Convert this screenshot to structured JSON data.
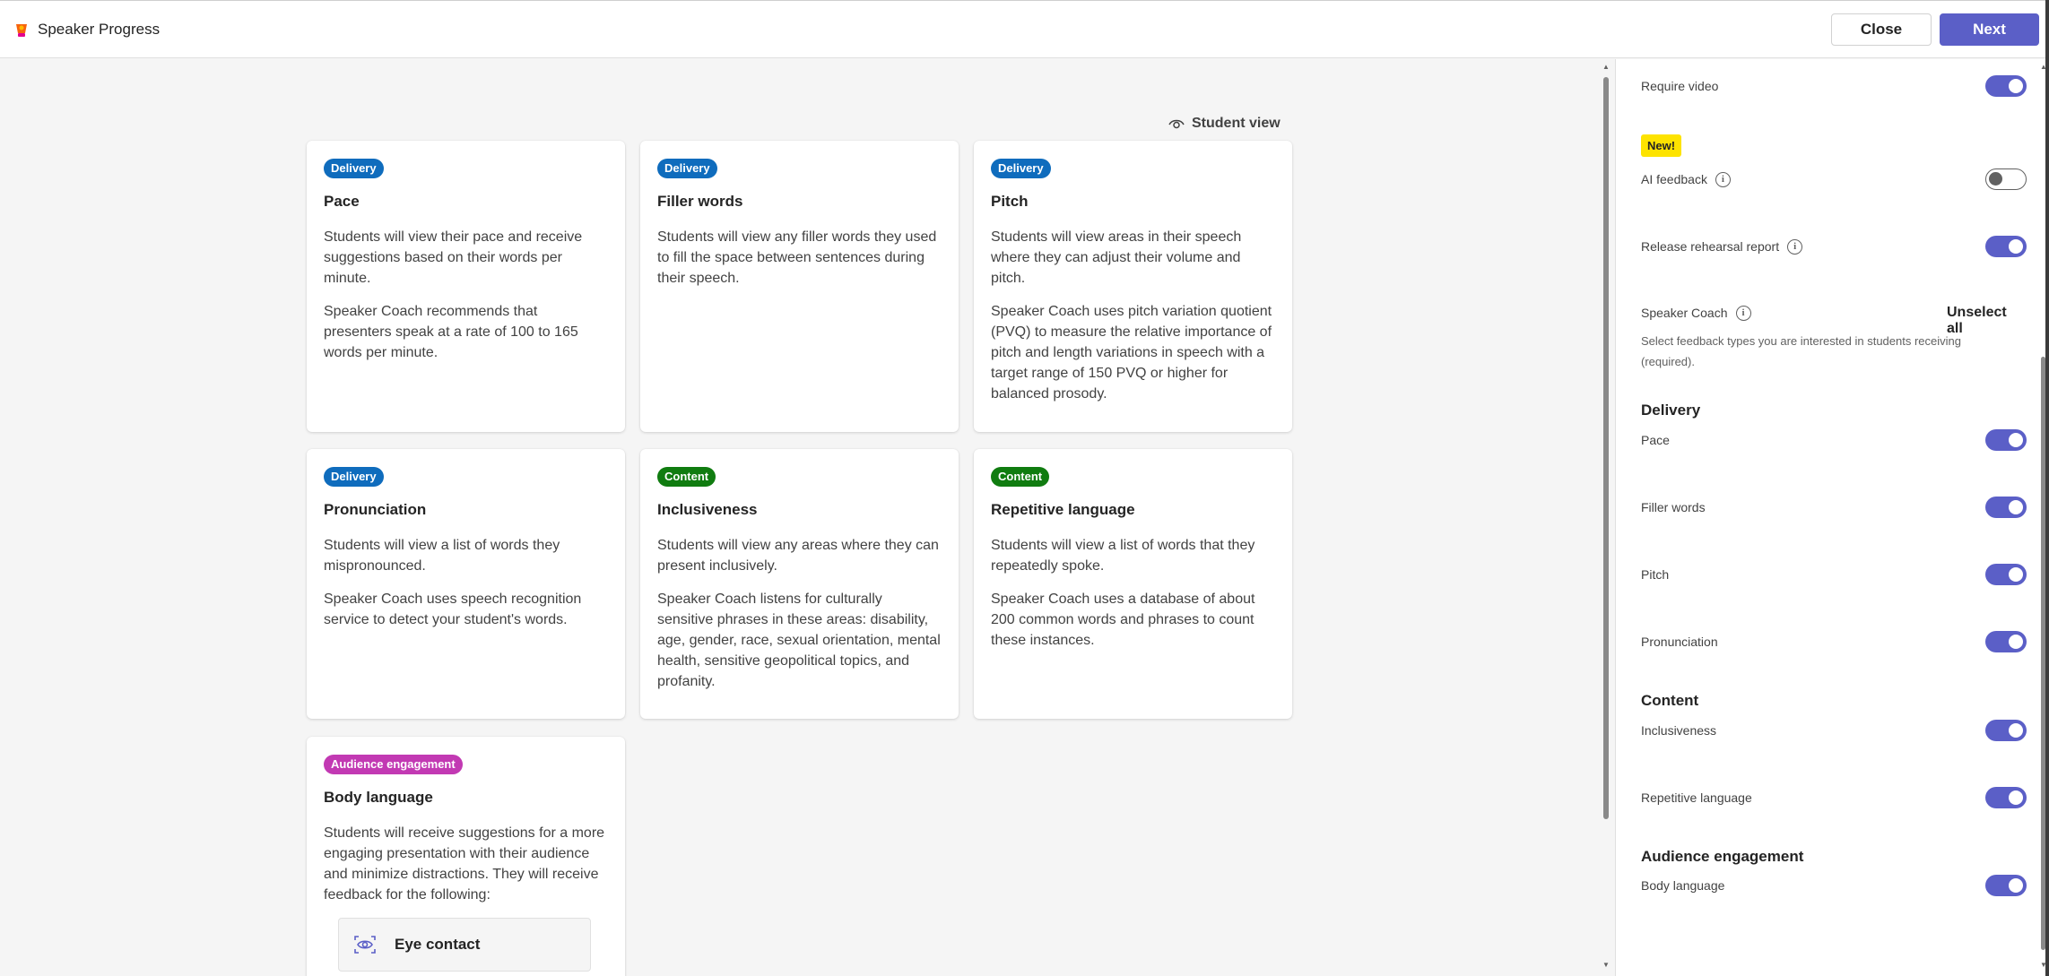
{
  "header": {
    "app_title": "Speaker Progress",
    "close_label": "Close",
    "next_label": "Next"
  },
  "main": {
    "student_view_label": "Student view",
    "cards": [
      {
        "tag": "Delivery",
        "title": "Pace",
        "paragraphs": [
          "Students will view their pace and receive suggestions based on their words per minute.",
          "Speaker Coach recommends that presenters speak at a rate of 100 to 165 words per minute."
        ]
      },
      {
        "tag": "Delivery",
        "title": "Filler words",
        "paragraphs": [
          "Students will view any filler words they used to fill the space between sentences during their speech."
        ]
      },
      {
        "tag": "Delivery",
        "title": "Pitch",
        "paragraphs": [
          "Students will view areas in their speech where they can adjust their volume and pitch.",
          "Speaker Coach uses pitch variation quotient (PVQ) to measure the relative importance of pitch and length variations in speech with a target range of 150 PVQ or higher for balanced prosody."
        ]
      },
      {
        "tag": "Delivery",
        "title": "Pronunciation",
        "paragraphs": [
          "Students will view a list of words they mispronounced.",
          "Speaker Coach uses speech recognition service to detect your student's words."
        ]
      },
      {
        "tag": "Content",
        "title": "Inclusiveness",
        "paragraphs": [
          "Students will view any areas where they can present inclusively.",
          "Speaker Coach listens for culturally sensitive phrases in these areas: disability, age, gender, race, sexual orientation, mental health, sensitive geopolitical topics, and profanity."
        ]
      },
      {
        "tag": "Content",
        "title": "Repetitive language",
        "paragraphs": [
          "Students will view a list of words that they repeatedly spoke.",
          "Speaker Coach uses a database of about 200 common words and phrases to count these instances."
        ]
      },
      {
        "tag": "Audience engagement",
        "title": "Body language",
        "paragraphs": [
          "Students will receive suggestions for a more engaging presentation with their audience and minimize distractions. They will receive feedback for the following:"
        ],
        "sub_item": "Eye contact"
      }
    ]
  },
  "panel": {
    "require_video": {
      "label": "Require video",
      "on": true
    },
    "new_badge": "New!",
    "ai_feedback": {
      "label": "AI feedback",
      "on": false
    },
    "release_report": {
      "label": "Release rehearsal report",
      "on": true
    },
    "speaker_coach_label": "Speaker Coach",
    "unselect_all": "Unselect all",
    "description": "Select feedback types you are interested in students receiving (required).",
    "sections": [
      {
        "heading": "Delivery",
        "items": [
          {
            "label": "Pace",
            "on": true
          },
          {
            "label": "Filler words",
            "on": true
          },
          {
            "label": "Pitch",
            "on": true
          },
          {
            "label": "Pronunciation",
            "on": true
          }
        ]
      },
      {
        "heading": "Content",
        "items": [
          {
            "label": "Inclusiveness",
            "on": true
          },
          {
            "label": "Repetitive language",
            "on": true
          }
        ]
      },
      {
        "heading": "Audience engagement",
        "items": [
          {
            "label": "Body language",
            "on": true
          }
        ]
      }
    ]
  },
  "colors": {
    "accent": "#5b5fc7",
    "delivery_tag": "#0f6cbd",
    "content_tag": "#107c10",
    "audience_tag": "#c239b3",
    "new_badge": "#fde300"
  },
  "icons": [
    "app-logo-icon",
    "eye-icon",
    "eye-contact-icon",
    "info-icon"
  ]
}
